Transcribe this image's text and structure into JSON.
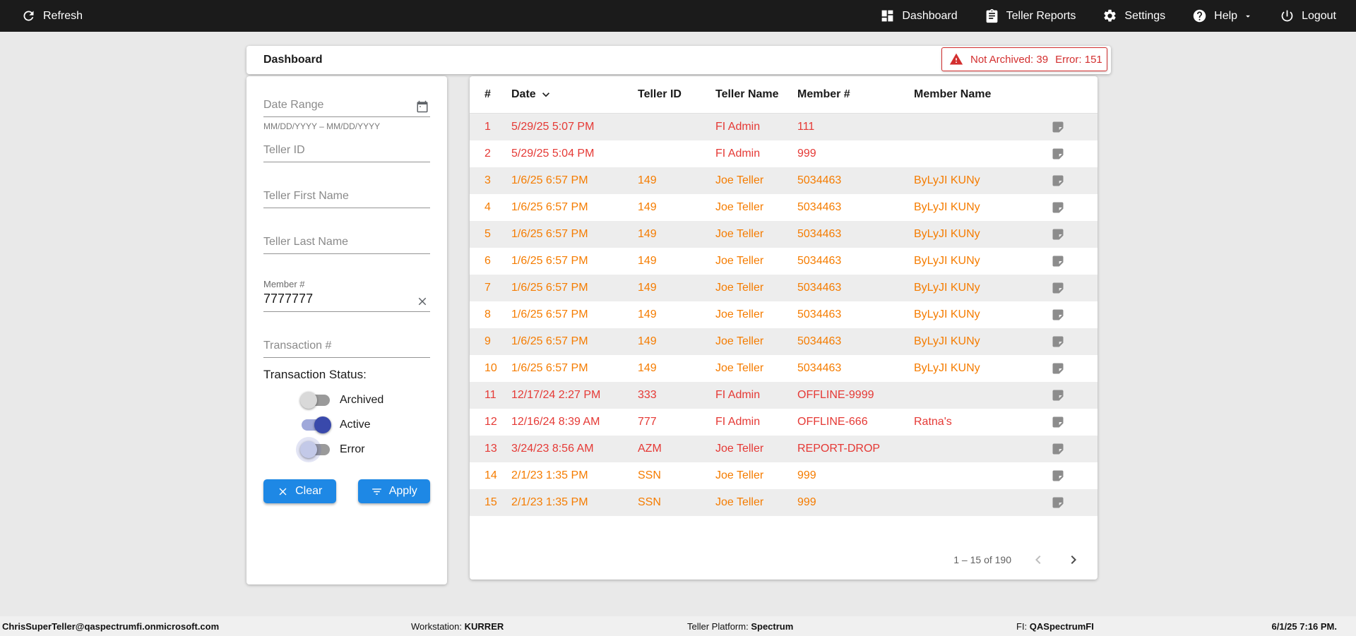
{
  "colors": {
    "accent_blue": "#1e88e5",
    "error_red": "#e53935",
    "warning_orange": "#f57c00",
    "alert_red": "#d32f2f",
    "toggle_active": "#3949ab"
  },
  "topbar": {
    "refresh_label": "Refresh",
    "nav": [
      {
        "label": "Dashboard"
      },
      {
        "label": "Teller Reports"
      },
      {
        "label": "Settings"
      },
      {
        "label": "Help"
      },
      {
        "label": "Logout"
      }
    ]
  },
  "page": {
    "title": "Dashboard",
    "alert": {
      "not_archived": "Not Archived: 39",
      "error": "Error: 151"
    }
  },
  "filters": {
    "date_range": {
      "placeholder": "Date Range",
      "helper": "MM/DD/YYYY – MM/DD/YYYY"
    },
    "teller_id_placeholder": "Teller ID",
    "teller_first_name_placeholder": "Teller First Name",
    "teller_last_name_placeholder": "Teller Last Name",
    "member_number": {
      "label": "Member #",
      "value": "7777777"
    },
    "transaction_placeholder": "Transaction #",
    "status": {
      "label": "Transaction Status:",
      "toggles": [
        {
          "label": "Archived",
          "state": "off",
          "halo": false
        },
        {
          "label": "Active",
          "state": "on",
          "halo": false
        },
        {
          "label": "Error",
          "state": "off",
          "halo": true
        }
      ]
    },
    "clear_label": "Clear",
    "apply_label": "Apply"
  },
  "table": {
    "columns": [
      "#",
      "Date",
      "Teller ID",
      "Teller Name",
      "Member #",
      "Member Name"
    ],
    "sort_column": "Date",
    "rows": [
      {
        "num": "1",
        "date": "5/29/25 5:07 PM",
        "teller_id": "",
        "teller_name": "FI Admin",
        "member": "111",
        "member_name": "",
        "severity": "red"
      },
      {
        "num": "2",
        "date": "5/29/25 5:04 PM",
        "teller_id": "",
        "teller_name": "FI Admin",
        "member": "999",
        "member_name": "",
        "severity": "red"
      },
      {
        "num": "3",
        "date": "1/6/25 6:57 PM",
        "teller_id": "149",
        "teller_name": "Joe Teller",
        "member": "5034463",
        "member_name": "ByLyJI KUNy",
        "severity": "orange"
      },
      {
        "num": "4",
        "date": "1/6/25 6:57 PM",
        "teller_id": "149",
        "teller_name": "Joe Teller",
        "member": "5034463",
        "member_name": "ByLyJI KUNy",
        "severity": "orange"
      },
      {
        "num": "5",
        "date": "1/6/25 6:57 PM",
        "teller_id": "149",
        "teller_name": "Joe Teller",
        "member": "5034463",
        "member_name": "ByLyJI KUNy",
        "severity": "orange"
      },
      {
        "num": "6",
        "date": "1/6/25 6:57 PM",
        "teller_id": "149",
        "teller_name": "Joe Teller",
        "member": "5034463",
        "member_name": "ByLyJI KUNy",
        "severity": "orange"
      },
      {
        "num": "7",
        "date": "1/6/25 6:57 PM",
        "teller_id": "149",
        "teller_name": "Joe Teller",
        "member": "5034463",
        "member_name": "ByLyJI KUNy",
        "severity": "orange"
      },
      {
        "num": "8",
        "date": "1/6/25 6:57 PM",
        "teller_id": "149",
        "teller_name": "Joe Teller",
        "member": "5034463",
        "member_name": "ByLyJI KUNy",
        "severity": "orange"
      },
      {
        "num": "9",
        "date": "1/6/25 6:57 PM",
        "teller_id": "149",
        "teller_name": "Joe Teller",
        "member": "5034463",
        "member_name": "ByLyJI KUNy",
        "severity": "orange"
      },
      {
        "num": "10",
        "date": "1/6/25 6:57 PM",
        "teller_id": "149",
        "teller_name": "Joe Teller",
        "member": "5034463",
        "member_name": "ByLyJI KUNy",
        "severity": "orange"
      },
      {
        "num": "11",
        "date": "12/17/24 2:27 PM",
        "teller_id": "333",
        "teller_name": "FI Admin",
        "member": "OFFLINE-9999",
        "member_name": "",
        "severity": "red"
      },
      {
        "num": "12",
        "date": "12/16/24 8:39 AM",
        "teller_id": "777",
        "teller_name": "FI Admin",
        "member": "OFFLINE-666",
        "member_name": "Ratna's",
        "severity": "red"
      },
      {
        "num": "13",
        "date": "3/24/23 8:56 AM",
        "teller_id": "AZM",
        "teller_name": "Joe Teller",
        "member": "REPORT-DROP",
        "member_name": "",
        "severity": "red"
      },
      {
        "num": "14",
        "date": "2/1/23 1:35 PM",
        "teller_id": "SSN",
        "teller_name": "Joe Teller",
        "member": "999",
        "member_name": "",
        "severity": "orange"
      },
      {
        "num": "15",
        "date": "2/1/23 1:35 PM",
        "teller_id": "SSN",
        "teller_name": "Joe Teller",
        "member": "999",
        "member_name": "",
        "severity": "orange"
      }
    ],
    "pagination": {
      "range_label": "1 – 15 of 190"
    }
  },
  "footer": {
    "user": "ChrisSuperTeller@qaspectrumfi.onmicrosoft.com",
    "workstation_label": "Workstation:",
    "workstation_value": "KURRER",
    "platform_label": "Teller Platform:",
    "platform_value": "Spectrum",
    "fi_label": "FI:",
    "fi_value": "QASpectrumFI",
    "datetime": "6/1/25 7:16 PM."
  }
}
